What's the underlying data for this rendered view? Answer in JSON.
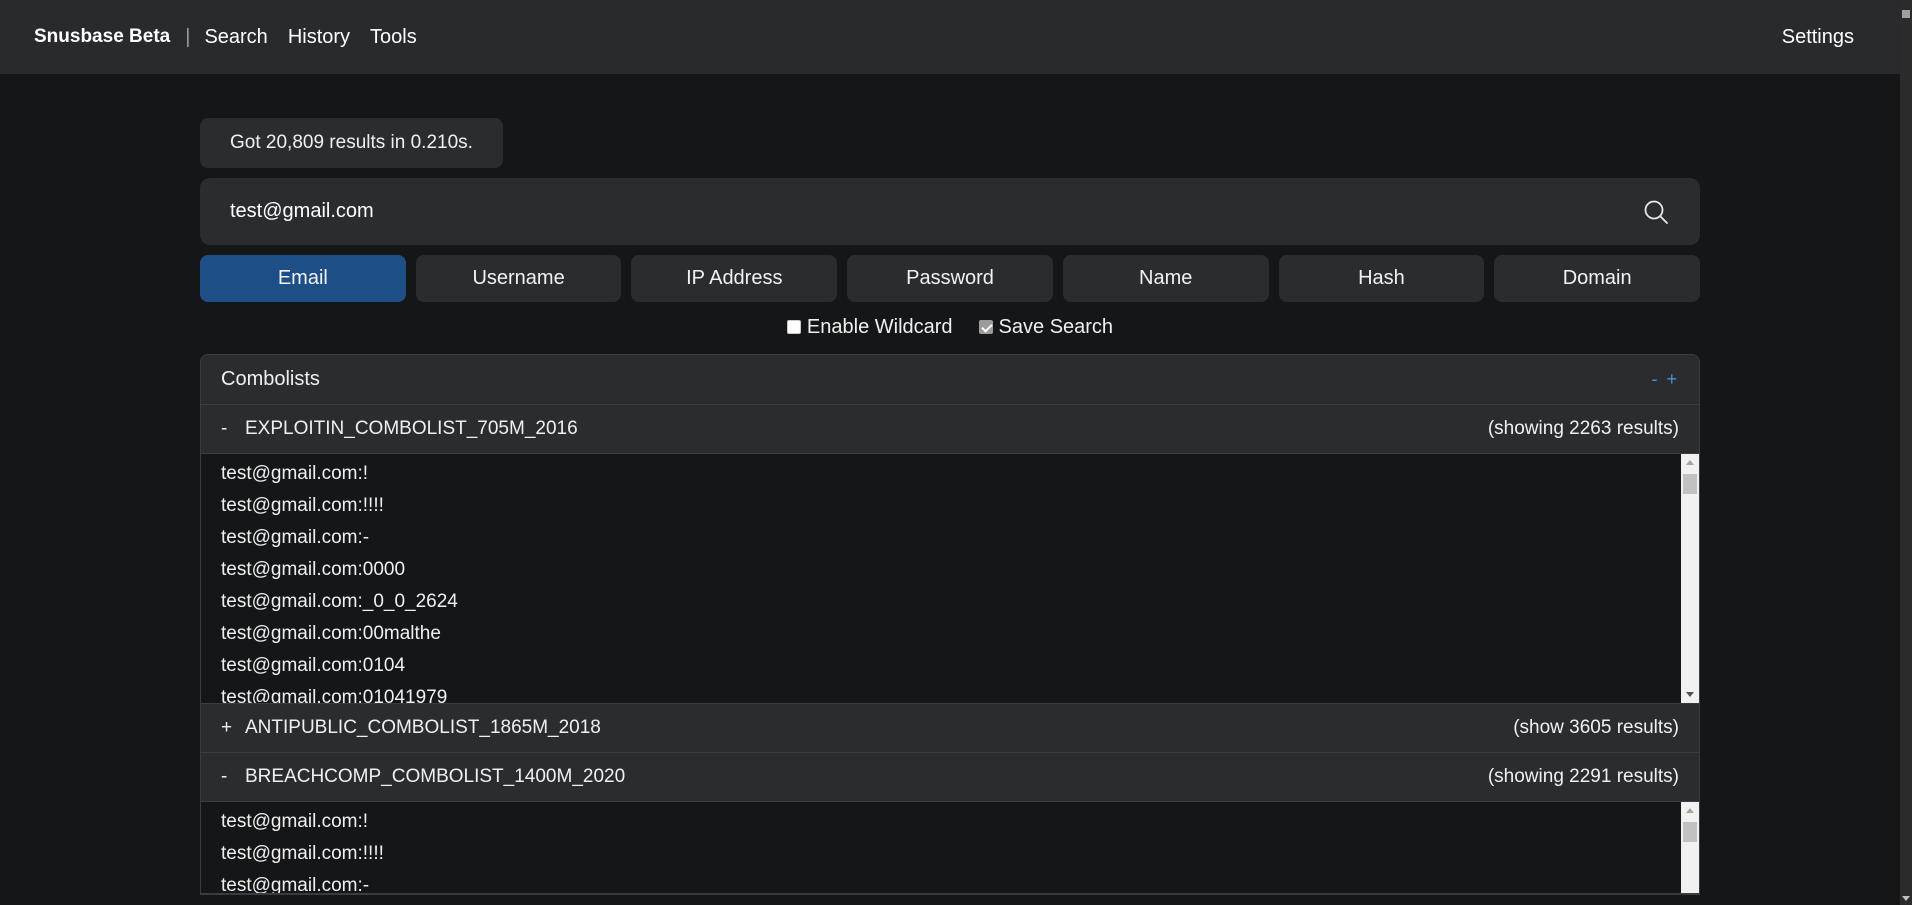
{
  "nav": {
    "brand": "Snusbase Beta",
    "separator": "|",
    "links": [
      "Search",
      "History",
      "Tools"
    ],
    "settings": "Settings"
  },
  "search": {
    "result_summary": "Got 20,809 results in 0.210s.",
    "query": "test@gmail.com",
    "types": [
      "Email",
      "Username",
      "IP Address",
      "Password",
      "Name",
      "Hash",
      "Domain"
    ],
    "active_type": "Email",
    "options": {
      "wildcard_label": "Enable Wildcard",
      "wildcard_checked": false,
      "save_label": "Save Search",
      "save_checked": true
    }
  },
  "combolists": {
    "title": "Combolists",
    "collapse_all": "-",
    "expand_all": "+",
    "groups": [
      {
        "sign": "-",
        "name": "EXPLOITIN_COMBOLIST_705M_2016",
        "count_label": "(showing 2263 results)",
        "expanded": true,
        "rows": [
          "test@gmail.com:!",
          "test@gmail.com:!!!!",
          "test@gmail.com:-",
          "test@gmail.com:0000",
          "test@gmail.com:_0_0_2624",
          "test@gmail.com:00malthe",
          "test@gmail.com:0104",
          "test@gmail.com:01041979"
        ]
      },
      {
        "sign": "+",
        "name": "ANTIPUBLIC_COMBOLIST_1865M_2018",
        "count_label": "(show 3605 results)",
        "expanded": false,
        "rows": []
      },
      {
        "sign": "-",
        "name": "BREACHCOMP_COMBOLIST_1400M_2020",
        "count_label": "(showing 2291 results)",
        "expanded": true,
        "rows": [
          "test@gmail.com:!",
          "test@gmail.com:!!!!",
          "test@gmail.com:-"
        ]
      }
    ]
  },
  "colors": {
    "nav_bg": "#282a2d",
    "page_bg": "#151617",
    "panel_bg": "#2a2c30",
    "active_type_bg": "#1d4f86",
    "toggle_link": "#4c8fd6"
  }
}
